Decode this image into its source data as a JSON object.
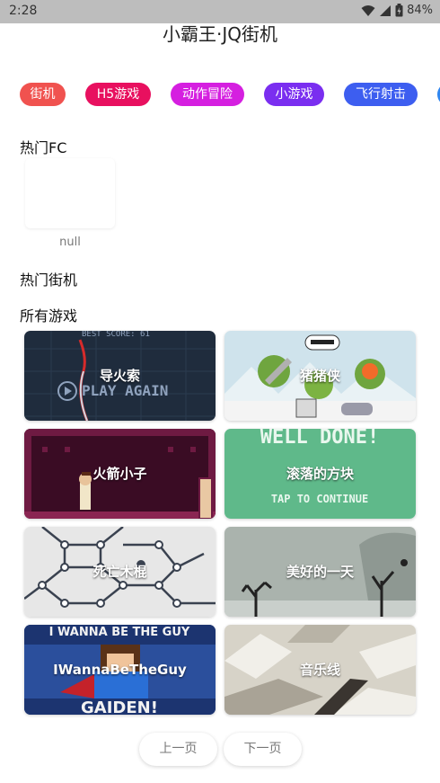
{
  "status": {
    "time": "2:28",
    "battery": "84%"
  },
  "app": {
    "title": "小霸王·JQ街机"
  },
  "chips": [
    {
      "label": "街机",
      "color": "#f0524f"
    },
    {
      "label": "H5游戏",
      "color": "#e8105f"
    },
    {
      "label": "动作冒险",
      "color": "#d51fe0"
    },
    {
      "label": "小游戏",
      "color": "#7a2ef0"
    },
    {
      "label": "飞行射击",
      "color": "#3d5ef0"
    }
  ],
  "sections": {
    "hot_fc": "热门FC",
    "hot_arcade": "热门街机",
    "all_games": "所有游戏"
  },
  "hot_fc_items": [
    {
      "name": "null"
    }
  ],
  "games": [
    {
      "title": "导火索",
      "icon": "fuse-game-thumbnail"
    },
    {
      "title": "猪猪侠",
      "icon": "pig-hero-game-thumbnail"
    },
    {
      "title": "火箭小子",
      "icon": "rocket-kid-game-thumbnail"
    },
    {
      "title": "滚落的方块",
      "icon": "falling-block-game-thumbnail"
    },
    {
      "title": "死亡木棍",
      "icon": "death-stick-game-thumbnail"
    },
    {
      "title": "美好的一天",
      "icon": "good-day-game-thumbnail"
    },
    {
      "title": "IWannaBeTheGuy",
      "icon": "iwannabetheguy-game-thumbnail"
    },
    {
      "title": "音乐线",
      "icon": "music-line-game-thumbnail"
    }
  ],
  "thumb_text": {
    "best_score": "BEST SCORE: 61",
    "play_again": "PLAY AGAIN",
    "well_done": "WELL DONE!",
    "tap_continue": "TAP TO CONTINUE",
    "iwanna_banner": "I WANNA BE THE GUY",
    "gaiden": "GAIDEN!"
  },
  "pager": {
    "prev": "上一页",
    "next": "下一页"
  }
}
